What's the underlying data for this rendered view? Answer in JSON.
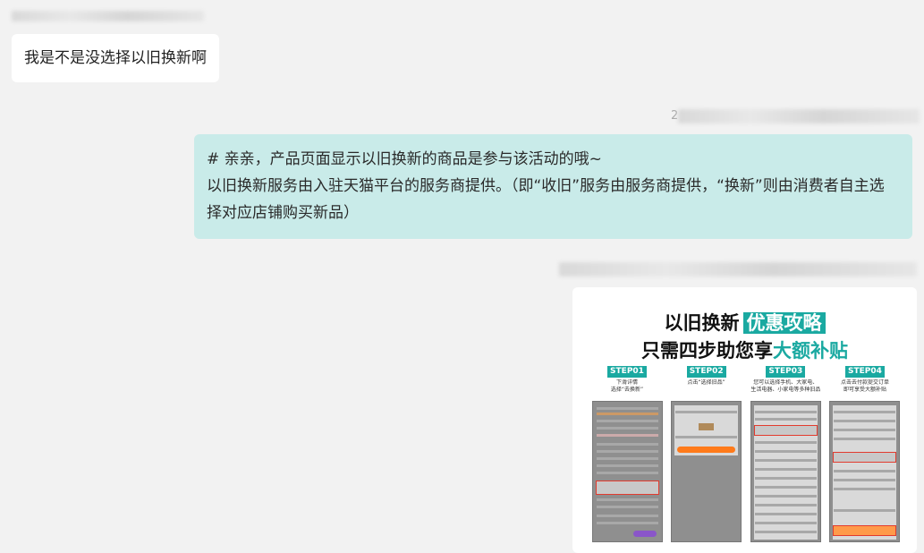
{
  "messages": [
    {
      "side": "left",
      "text": "我是不是没选择以旧换新啊"
    },
    {
      "side": "right",
      "timestamp_prefix": "2",
      "lines": [
        "# 亲亲，产品页面显示以旧换新的商品是参与该活动的哦~",
        "以旧换新服务由入驻天猫平台的服务商提供。（即“收旧”服务由服务商提供，“换新”则由消费者自主选择对应店铺购买新品）"
      ]
    }
  ],
  "promo_image": {
    "title_line1_prefix": "以旧换新",
    "title_line1_highlight": "优惠攻略",
    "title_line2_prefix": "只需四步助您享",
    "title_line2_highlight": "大额补贴",
    "steps": [
      {
        "badge": "STEP01",
        "desc": "下滑详情\n选择“去换新”"
      },
      {
        "badge": "STEP02",
        "desc": "点击“选择旧品”"
      },
      {
        "badge": "STEP03",
        "desc": "您可以选择手机、大家电、\n生活电器、小家电等多种旧品"
      },
      {
        "badge": "STEP04",
        "desc": "点击去付款提交订单\n即可享受大额补贴"
      }
    ],
    "accent_color": "#1aa9a1"
  },
  "colors": {
    "background": "#f2f2f2",
    "left_bubble": "#ffffff",
    "right_bubble": "#c9ebe9"
  }
}
